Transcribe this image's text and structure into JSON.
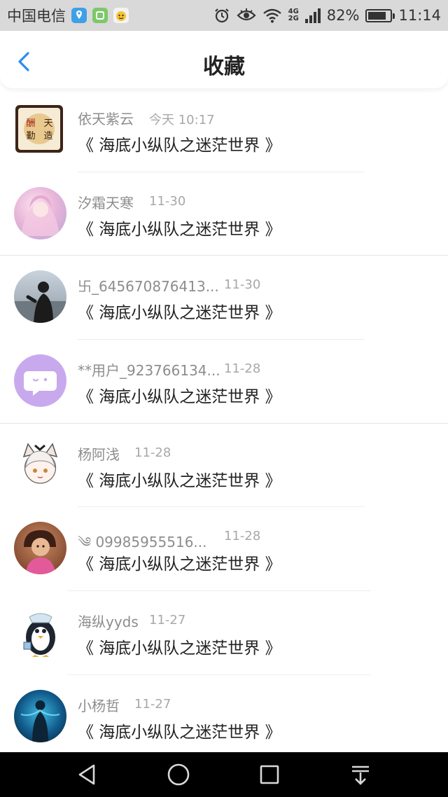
{
  "status_bar": {
    "carrier": "中国电信",
    "network_top": "4G",
    "network_bottom": "2G",
    "battery_percent": "82%",
    "battery_level": 0.82,
    "time": "11:14"
  },
  "header": {
    "title": "收藏"
  },
  "favorites": [
    {
      "name": "依天紫云",
      "time": "今天 10:17",
      "work": "《 海底小纵队之迷茫世界 》"
    },
    {
      "name": "汐霜天寒",
      "time": "11-30",
      "work": "《 海底小纵队之迷茫世界 》"
    },
    {
      "name": "卐_645670876413...",
      "time": "11-30",
      "work": "《 海底小纵队之迷茫世界 》"
    },
    {
      "name": "**用户_923766134...",
      "time": "11-28",
      "work": "《 海底小纵队之迷茫世界 》"
    },
    {
      "name": "杨阿浅",
      "time": "11-28",
      "work": "《 海底小纵队之迷茫世界 》"
    },
    {
      "name": "༄ 09985955516...",
      "time": "11-28",
      "work": "《 海底小纵队之迷茫世界 》"
    },
    {
      "name": "海纵yyds",
      "time": "11-27",
      "work": "《 海底小纵队之迷茫世界 》"
    },
    {
      "name": "小杨哲",
      "time": "11-27",
      "work": "《 海底小纵队之迷茫世界 》"
    }
  ],
  "avatar_seal_text": [
    "天",
    "造",
    "酬",
    "勤"
  ],
  "colors": {
    "accent": "#2a8ef0",
    "name_gray": "#8d8d8d",
    "time_gray": "#a8a8a8",
    "chat_avatar_purple": "#c9a9ee"
  },
  "icons": [
    "location-icon",
    "app-icon",
    "mascot-icon",
    "alarm-icon",
    "eye-icon",
    "wifi-icon",
    "signal-icon",
    "battery-icon",
    "back-icon",
    "nav-back-icon",
    "nav-home-icon",
    "nav-recents-icon",
    "nav-notification-icon"
  ]
}
